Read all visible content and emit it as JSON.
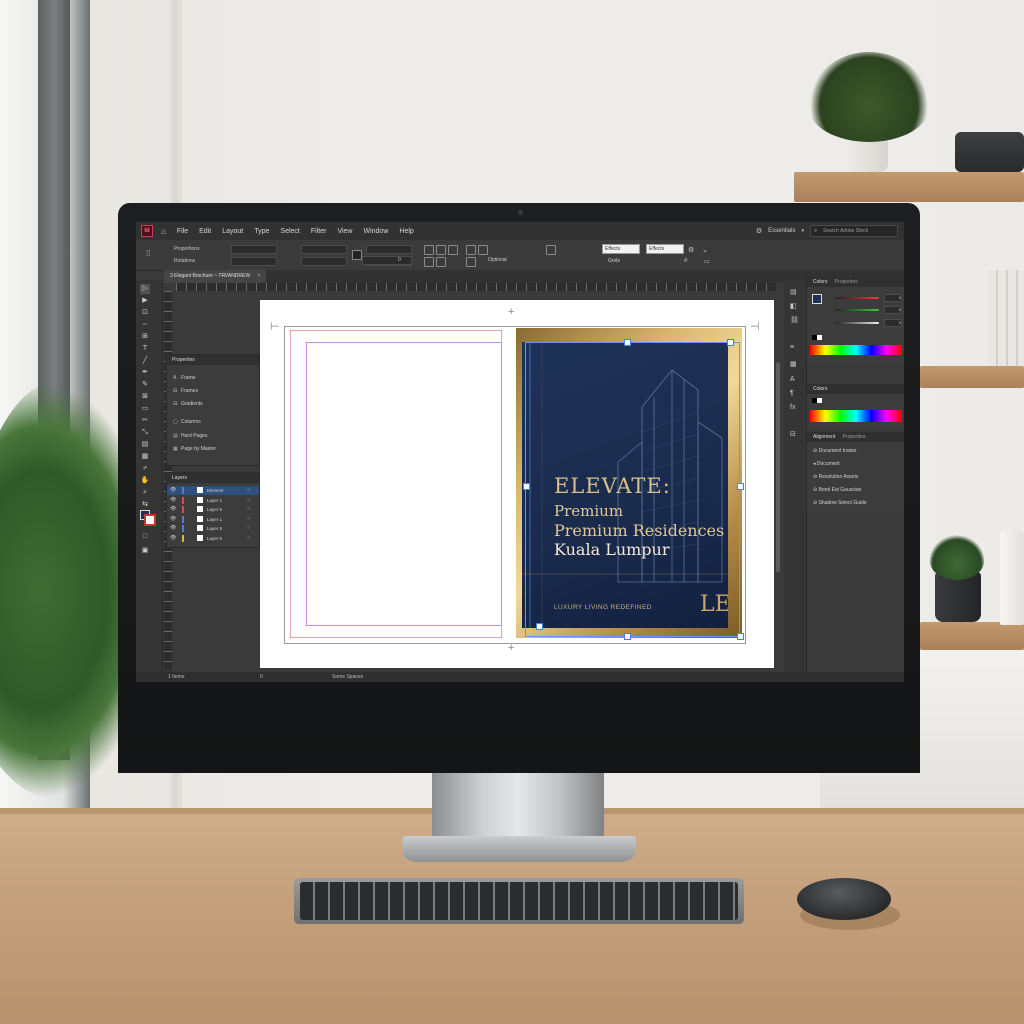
{
  "app": {
    "logo_letter": "Id",
    "menu": [
      "File",
      "Edit",
      "Layout",
      "Type",
      "Select",
      "Filter",
      "View",
      "Window",
      "Help"
    ],
    "workspace": "Essentials",
    "search_placeholder": "Search Adobe Stock"
  },
  "control_bar": {
    "row1_label": "Proportions",
    "row2_label": "Rotations",
    "field_value_a": "0",
    "dropdown_a": "Effects",
    "dropdown_b": "Effects",
    "row2_text_a": "Optional",
    "row2_text_b": "Grids"
  },
  "document": {
    "tab_title": "3 Elegant Brochure ~ TRI/ANDREW",
    "close_glyph": "×"
  },
  "brochure": {
    "headline": "ELEVATE:",
    "line1": "Premium",
    "line2": "Premium Residences",
    "line3": "Kuala Lumpur",
    "tagline": "LUXURY LIVING REDEFINED",
    "monogram": "LE",
    "navy": "#1a2b4d",
    "gold": "#d9b76f"
  },
  "pages_panel": {
    "title": "Properties",
    "rows": [
      "Frame",
      "Frames",
      "Gradients",
      "Columns",
      "Hard Pages",
      "Page by Master"
    ]
  },
  "layers_panel": {
    "title": "Layers",
    "rows": [
      {
        "name": "Element",
        "color": "#4a7ed8",
        "selected": true
      },
      {
        "name": "Layer 1",
        "color": "#d94b4b",
        "selected": false
      },
      {
        "name": "Layer 5",
        "color": "#d94b4b",
        "selected": false
      },
      {
        "name": "Layer 1",
        "color": "#4a7ed8",
        "selected": false
      },
      {
        "name": "Layer 5",
        "color": "#4a7ed8",
        "selected": false
      },
      {
        "name": "Layer 5",
        "color": "#d9b24b",
        "selected": false
      }
    ]
  },
  "color_panel": {
    "tabs": [
      "Colors",
      "Properties"
    ],
    "values": [
      "0",
      "0",
      "0"
    ]
  },
  "swatches_panel": {
    "tab": "Colors"
  },
  "align_panel": {
    "tabs": [
      "Alignment",
      "Properties"
    ],
    "rows": [
      "Document Instan",
      "Document",
      "Resolution Assets",
      "Bond Est Gaussian",
      "Shadow Select Guide"
    ]
  },
  "status_bar": {
    "page_label": "1 Items",
    "mid_label": "Some Spaces",
    "zoom": "0"
  }
}
